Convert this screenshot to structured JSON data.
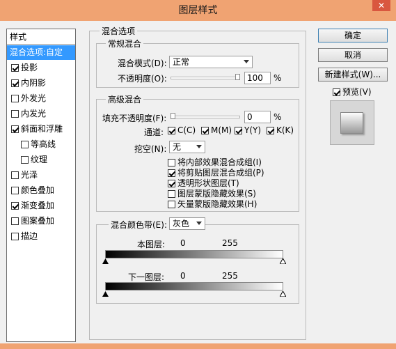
{
  "window": {
    "title": "图层样式",
    "close_label": "✕"
  },
  "styles_panel": {
    "header": "样式",
    "items": [
      {
        "label": "混合选项:自定",
        "checkbox": false,
        "checked": false,
        "selected": true,
        "indent": false
      },
      {
        "label": "投影",
        "checkbox": true,
        "checked": true,
        "selected": false,
        "indent": false
      },
      {
        "label": "内阴影",
        "checkbox": true,
        "checked": true,
        "selected": false,
        "indent": false
      },
      {
        "label": "外发光",
        "checkbox": true,
        "checked": false,
        "selected": false,
        "indent": false
      },
      {
        "label": "内发光",
        "checkbox": true,
        "checked": false,
        "selected": false,
        "indent": false
      },
      {
        "label": "斜面和浮雕",
        "checkbox": true,
        "checked": true,
        "selected": false,
        "indent": false
      },
      {
        "label": "等高线",
        "checkbox": true,
        "checked": false,
        "selected": false,
        "indent": true
      },
      {
        "label": "纹理",
        "checkbox": true,
        "checked": false,
        "selected": false,
        "indent": true
      },
      {
        "label": "光泽",
        "checkbox": true,
        "checked": false,
        "selected": false,
        "indent": false
      },
      {
        "label": "颜色叠加",
        "checkbox": true,
        "checked": false,
        "selected": false,
        "indent": false
      },
      {
        "label": "渐变叠加",
        "checkbox": true,
        "checked": true,
        "selected": false,
        "indent": false
      },
      {
        "label": "图案叠加",
        "checkbox": true,
        "checked": false,
        "selected": false,
        "indent": false
      },
      {
        "label": "描边",
        "checkbox": true,
        "checked": false,
        "selected": false,
        "indent": false
      }
    ]
  },
  "blend_options": {
    "title": "混合选项",
    "general": {
      "title": "常规混合",
      "mode_label": "混合模式(D):",
      "mode_value": "正常",
      "opacity_label": "不透明度(O):",
      "opacity_value": "100",
      "opacity_fraction": 1.0,
      "percent": "%"
    },
    "advanced": {
      "title": "高级混合",
      "fill_label": "填充不透明度(F):",
      "fill_value": "0",
      "fill_fraction": 0.0,
      "percent": "%",
      "channels_label": "通道:",
      "channels": [
        {
          "label": "C(C)",
          "checked": true
        },
        {
          "label": "M(M)",
          "checked": true
        },
        {
          "label": "Y(Y)",
          "checked": true
        },
        {
          "label": "K(K)",
          "checked": true
        }
      ],
      "knockout_label": "挖空(N):",
      "knockout_value": "无",
      "options": [
        {
          "label": "将内部效果混合成组(I)",
          "checked": false
        },
        {
          "label": "将剪贴图层混合成组(P)",
          "checked": true
        },
        {
          "label": "透明形状图层(T)",
          "checked": true
        },
        {
          "label": "图层蒙版隐藏效果(S)",
          "checked": false
        },
        {
          "label": "矢量蒙版隐藏效果(H)",
          "checked": false
        }
      ]
    },
    "blend_if": {
      "label": "混合颜色带(E):",
      "value": "灰色",
      "this_layer_label": "本图层:",
      "this_layer_min": "0",
      "this_layer_max": "255",
      "underlying_label": "下一图层:",
      "underlying_min": "0",
      "underlying_max": "255"
    }
  },
  "buttons": {
    "ok": "确定",
    "cancel": "取消",
    "new_style": "新建样式(W)...",
    "preview_label": "预览(V)",
    "preview_checked": true
  }
}
